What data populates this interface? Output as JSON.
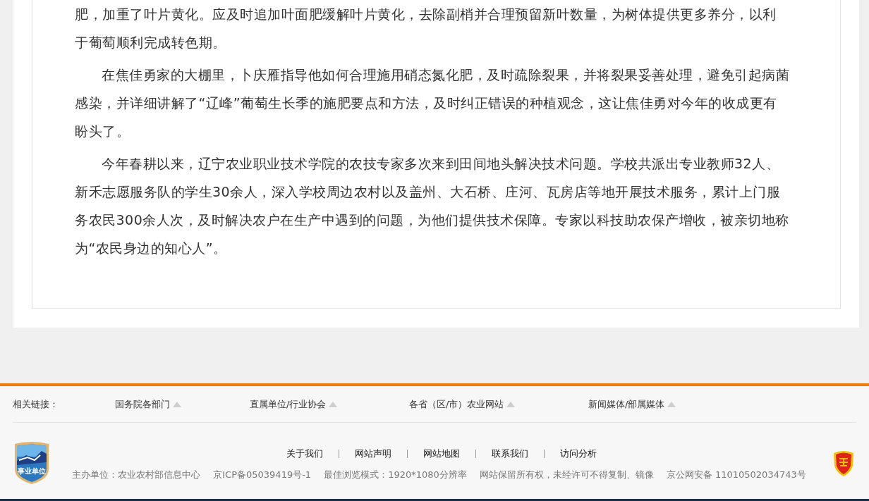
{
  "article": {
    "paragraphs": [
      {
        "text": "肥，加重了叶片黄化。应及时追加叶面肥缓解叶片黄化，去除副梢并合理预留新叶数量，为树体提供更多养分，以利于葡萄顺利完成转色期。",
        "continued": true
      },
      {
        "text": "在焦佳勇家的大棚里，卜庆雁指导他如何合理施用硝态氮化肥，及时疏除裂果，并将裂果妥善处理，避免引起病菌感染，并详细讲解了“辽峰”葡萄生长季的施肥要点和方法，及时纠正错误的种植观念，这让焦佳勇对今年的收成更有盼头了。",
        "continued": false
      },
      {
        "text": "今年春耕以来，辽宁农业职业技术学院的农技专家多次来到田间地头解决技术问题。学校共派出专业教师32人、新禾志愿服务队的学生30余人，深入学校周边农村以及盖州、大石桥、庄河、瓦房店等地开展技术服务，累计上门服务农民300余人次，及时解决农户在生产中遇到的问题，为他们提供技术保障。专家以科技助农保产增收，被亲切地称为“农民身边的知心人”。",
        "continued": false
      }
    ]
  },
  "footer": {
    "related_links": {
      "label": "相关链接：",
      "items": [
        "国务院各部门",
        "直属单位/行业协会",
        "各省（区/市）农业网站",
        "新闻媒体/部属媒体"
      ]
    },
    "nav_links": [
      "关于我们",
      "网站声明",
      "网站地图",
      "联系我们",
      "访问分析"
    ],
    "emblem_text": "事业单位",
    "info": [
      "主办单位：农业农村部信息中心",
      "京ICP备05039419号-1",
      "最佳浏览模式：1920*1080分辨率",
      "网站保留所有权，未经许可不得复制、镜像",
      "京公网安备 11010502034743号"
    ]
  }
}
